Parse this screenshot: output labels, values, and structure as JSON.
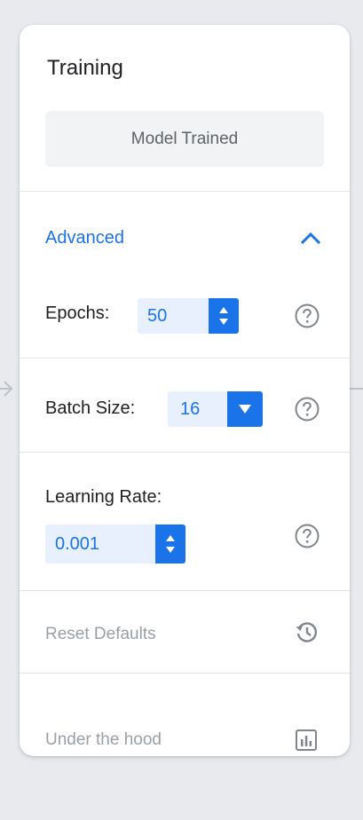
{
  "panel": {
    "title": "Training",
    "status_button": "Model Trained"
  },
  "advanced": {
    "label": "Advanced",
    "toggle_icon": "chevron-up-icon",
    "epochs": {
      "label": "Epochs:",
      "value": "50"
    },
    "batch_size": {
      "label": "Batch Size:",
      "value": "16"
    },
    "learning_rate": {
      "label": "Learning Rate:",
      "value": "0.001"
    },
    "help_icon": "help-circle-icon"
  },
  "footer": {
    "reset_label": "Reset Defaults",
    "reset_icon": "history-icon",
    "under_hood_label": "Under the hood",
    "under_hood_icon": "bar-chart-icon"
  },
  "colors": {
    "accent": "#1a73e8",
    "accent_light": "#e8f0fe",
    "muted_text": "#9aa0a6",
    "status_bg": "#f1f3f4"
  }
}
